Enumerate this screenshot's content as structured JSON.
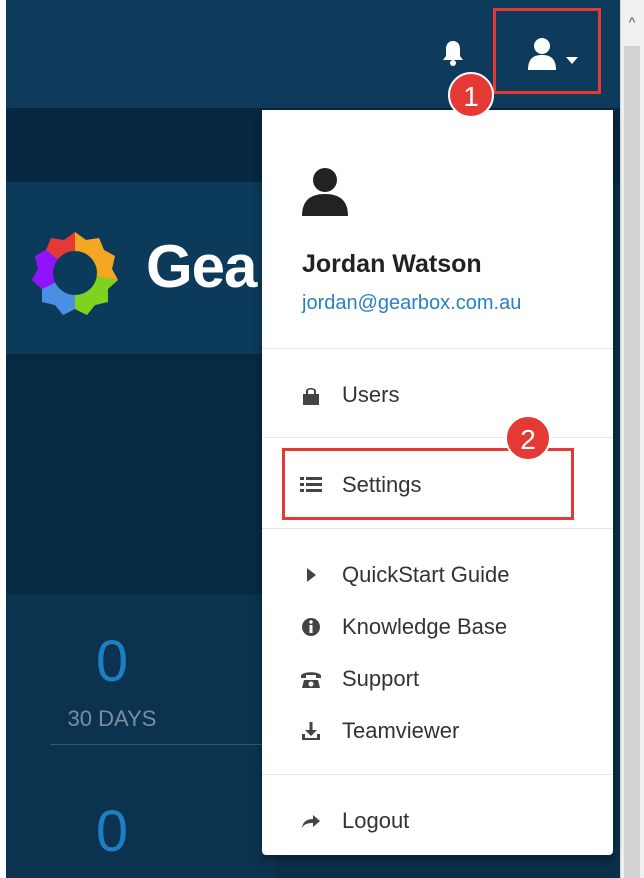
{
  "header": {
    "bell_icon": "bell-icon",
    "user_icon": "user-icon",
    "caret_icon": "caret-down-icon"
  },
  "brand": {
    "logo_text": "Gea"
  },
  "stats": [
    {
      "value": "0",
      "label": "30 DAYS"
    },
    {
      "value": "0",
      "label": ""
    }
  ],
  "callouts": {
    "first": "1",
    "second": "2"
  },
  "dropdown": {
    "user_name": "Jordan Watson",
    "user_email": "jordan@gearbox.com.au",
    "items": [
      {
        "label": "Users",
        "icon": "lock-icon"
      },
      {
        "label": "Settings",
        "icon": "list-icon"
      },
      {
        "label": "QuickStart Guide",
        "icon": "play-icon"
      },
      {
        "label": "Knowledge Base",
        "icon": "info-icon"
      },
      {
        "label": "Support",
        "icon": "phone-icon"
      },
      {
        "label": "Teamviewer",
        "icon": "download-icon"
      },
      {
        "label": "Logout",
        "icon": "arrow-right-icon"
      }
    ]
  },
  "colors": {
    "nav_bg": "#0e3a5c",
    "accent_red": "#e53935",
    "link_blue": "#2a7fc6",
    "stat_blue": "#1d7ec3"
  }
}
